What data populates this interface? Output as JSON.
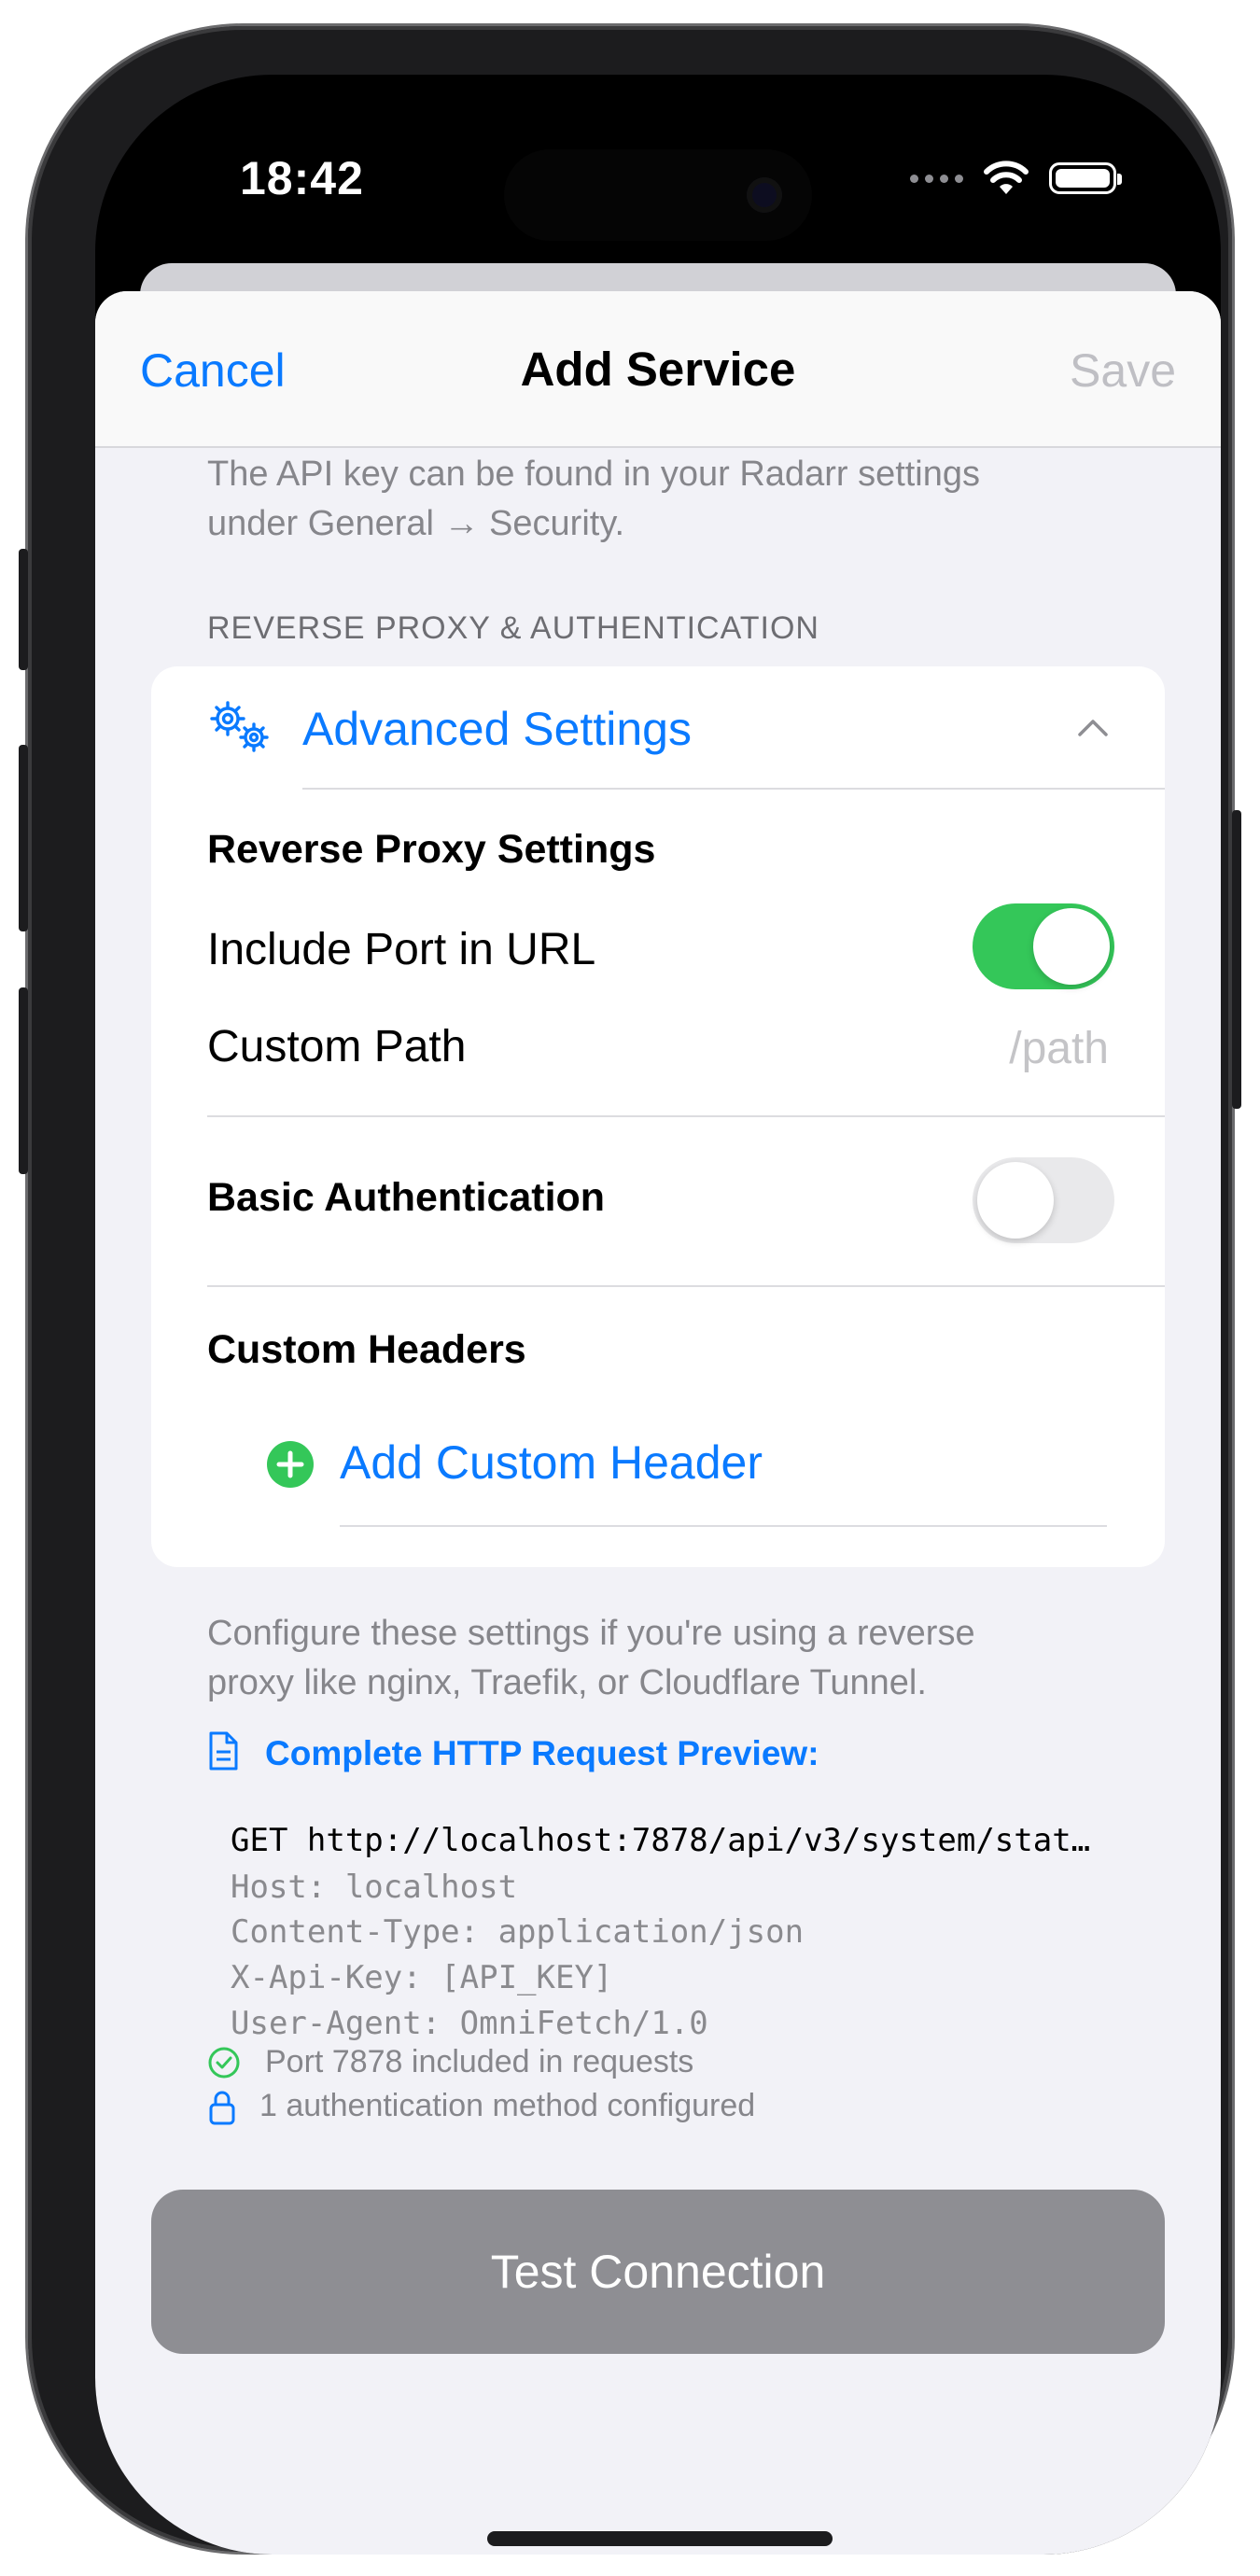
{
  "status_bar": {
    "time": "18:42"
  },
  "nav": {
    "cancel": "Cancel",
    "title": "Add Service",
    "save": "Save"
  },
  "api_note": {
    "line1": "The API key can be found in your Radarr settings",
    "line2": "under General → Security."
  },
  "section": {
    "label": "REVERSE PROXY & AUTHENTICATION"
  },
  "advanced": {
    "label": "Advanced Settings",
    "icon": "gear-icon",
    "expanded": true,
    "reverse_proxy_heading": "Reverse Proxy Settings",
    "include_port_label": "Include Port in URL",
    "include_port_on": true,
    "custom_path_label": "Custom Path",
    "custom_path_placeholder": "/path",
    "basic_auth_label": "Basic Authentication",
    "basic_auth_on": false,
    "custom_headers_heading": "Custom Headers",
    "add_header_label": "Add Custom Header"
  },
  "footer_note": {
    "line1": "Configure these settings if you're using a reverse",
    "line2": "proxy like nginx, Traefik, or Cloudflare Tunnel."
  },
  "preview": {
    "title": "Complete HTTP Request Preview:",
    "lines": [
      "GET http://localhost:7878/api/v3/system/stat…",
      "Host: localhost",
      "Content-Type: application/json",
      "X-Api-Key: [API_KEY]",
      "User-Agent: OmniFetch/1.0"
    ]
  },
  "info": {
    "port_line": "Port 7878 included in requests",
    "auth_line": "1 authentication method configured"
  },
  "test_button": {
    "label": "Test Connection"
  },
  "colors": {
    "accent": "#0a7aff",
    "toggle_on": "#34c759",
    "button_disabled": "#8e8e93",
    "background": "#f2f2f7"
  }
}
